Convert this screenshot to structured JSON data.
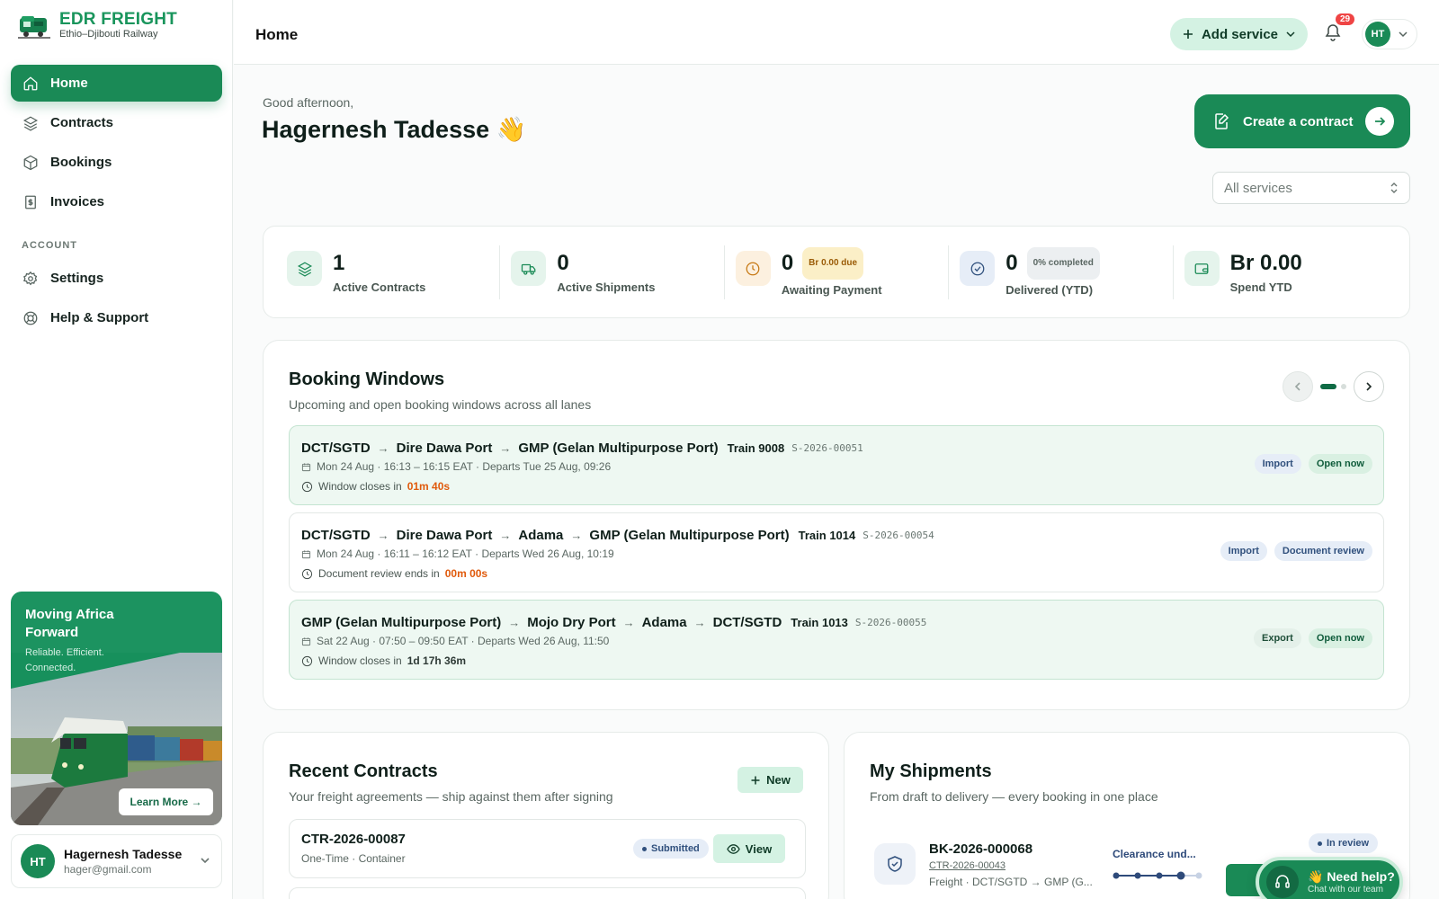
{
  "brand": {
    "name": "EDR FREIGHT",
    "subtitle": "Ethio–Djibouti Railway"
  },
  "sidebar": {
    "items": [
      {
        "label": "Home",
        "icon": "home-icon",
        "active": true
      },
      {
        "label": "Contracts",
        "icon": "layers-icon"
      },
      {
        "label": "Bookings",
        "icon": "box-icon"
      },
      {
        "label": "Invoices",
        "icon": "receipt-icon"
      }
    ],
    "account_heading": "ACCOUNT",
    "account_items": [
      {
        "label": "Settings",
        "icon": "gear-icon"
      },
      {
        "label": "Help & Support",
        "icon": "lifebuoy-icon"
      }
    ],
    "promo": {
      "title": "Moving Africa Forward",
      "subtitle": "Reliable. Efficient. Connected.",
      "button": "Learn More →"
    },
    "user": {
      "initials": "HT",
      "name": "Hagernesh Tadesse",
      "email": "hager@gmail.com"
    }
  },
  "topbar": {
    "title": "Home",
    "add_service": "Add service",
    "notification_count": "29",
    "user_initials": "HT"
  },
  "greeting": {
    "salutation": "Good afternoon,",
    "name": "Hagernesh Tadesse 👋"
  },
  "create_contract": "Create a contract",
  "services_filter": {
    "selected": "All services"
  },
  "stats": [
    {
      "value": "1",
      "label": "Active Contracts",
      "badge": "",
      "icon": "layers-icon"
    },
    {
      "value": "0",
      "label": "Active Shipments",
      "badge": "",
      "icon": "truck-icon"
    },
    {
      "value": "0",
      "label": "Awaiting Payment",
      "badge": "Br 0.00 due",
      "icon": "clock-icon"
    },
    {
      "value": "0",
      "label": "Delivered (YTD)",
      "badge": "0% completed",
      "icon": "check-circle-icon"
    },
    {
      "value": "Br 0.00",
      "label": "Spend YTD",
      "badge": "",
      "icon": "wallet-icon"
    }
  ],
  "booking_windows": {
    "title": "Booking Windows",
    "subtitle": "Upcoming and open booking windows across all lanes",
    "windows": [
      {
        "stops": [
          "DCT/SGTD",
          "Dire Dawa Port",
          "GMP (Gelan Multipurpose Port)"
        ],
        "train": "Train 9008",
        "code": "S-2026-00051",
        "schedule": "Mon 24 Aug · 16:13 – 16:15 EAT · Departs Tue 25 Aug, 09:26",
        "closes_label": "Window closes in",
        "countdown": "01m 40s",
        "tags": [
          "Import",
          "Open now"
        ]
      },
      {
        "stops": [
          "DCT/SGTD",
          "Dire Dawa Port",
          "Adama",
          "GMP (Gelan Multipurpose Port)"
        ],
        "train": "Train 1014",
        "code": "S-2026-00054",
        "schedule": "Mon 24 Aug · 16:11 – 16:12 EAT · Departs Wed 26 Aug, 10:19",
        "closes_label": "Document review ends in",
        "countdown": "00m 00s",
        "tags": [
          "Import",
          "Document review"
        ]
      },
      {
        "stops": [
          "GMP (Gelan Multipurpose Port)",
          "Mojo Dry Port",
          "Adama",
          "DCT/SGTD"
        ],
        "train": "Train 1013",
        "code": "S-2026-00055",
        "schedule": "Sat 22 Aug · 07:50 – 09:50 EAT · Departs Wed 26 Aug, 11:50",
        "closes_label": "Window closes in",
        "countdown": "1d 17h 36m",
        "tags": [
          "Export",
          "Open now"
        ]
      }
    ]
  },
  "recent_contracts": {
    "title": "Recent Contracts",
    "subtitle": "Your freight agreements — ship against them after signing",
    "new_label": "New",
    "rows": [
      {
        "id": "CTR-2026-00087",
        "type": "One-Time · Container",
        "status": "Submitted",
        "action": "View"
      }
    ]
  },
  "my_shipments": {
    "title": "My Shipments",
    "subtitle": "From draft to delivery — every booking in one place",
    "rows": [
      {
        "id": "BK-2026-000068",
        "contract": "CTR-2026-00043",
        "route": "Freight · DCT/SGTD → GMP (G...",
        "stage": "Clearance und...",
        "status": "In review"
      }
    ]
  },
  "help": {
    "title": "👋 Need help?",
    "subtitle": "Chat with our team"
  }
}
